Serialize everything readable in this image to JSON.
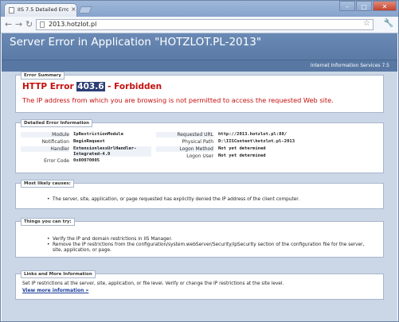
{
  "browser": {
    "tab_title": "IIS 7.5 Detailed Error - 403...",
    "tab_close": "×",
    "url": "2013.hotzlot.pl",
    "controls": {
      "minimize": "–",
      "maximize": "□",
      "close": "✕"
    }
  },
  "page": {
    "title": "Server Error in Application \"HOTZLOT.PL-2013\"",
    "product": "Internet Information Services 7.5"
  },
  "error_summary": {
    "section_title": "Error Summary",
    "prefix": "HTTP Error",
    "code": "403.6",
    "status": " - Forbidden",
    "description": "The IP address from which you are browsing is not permitted to access the requested Web site."
  },
  "detailed": {
    "section_title": "Detailed Error Information",
    "left": [
      {
        "label": "Module",
        "value": "IpRestrictionModule"
      },
      {
        "label": "Notification",
        "value": "BeginRequest"
      },
      {
        "label": "Handler",
        "value": "ExtensionlessUrlHandler-Integrated-4.0"
      },
      {
        "label": "Error Code",
        "value": "0x80070005"
      }
    ],
    "right": [
      {
        "label": "Requested URL",
        "value": "http://2013.hotzlot.pl:80/"
      },
      {
        "label": "Physical Path",
        "value": "D:\\IISContent\\hotzlot.pl-2013"
      },
      {
        "label": "Logon Method",
        "value": "Not yet determined"
      },
      {
        "label": "Logon User",
        "value": "Not yet determined"
      }
    ]
  },
  "causes": {
    "section_title": "Most likely causes:",
    "items": [
      "The server, site, application, or page requested has explicitly denied the IP address of the client computer."
    ]
  },
  "try": {
    "section_title": "Things you can try:",
    "items": [
      "Verify the IP and domain restrictions in IIS Manager.",
      "Remove the IP restrictions from the configuration/system.webServer/Security/ipSecurity section of the configuration file for the server, site, application, or page."
    ]
  },
  "links": {
    "section_title": "Links and More Information",
    "text": "Set IP restrictions at the server, site, application, or file level. Verify or change the IP restrictions at the site level.",
    "more": "View more information »"
  }
}
